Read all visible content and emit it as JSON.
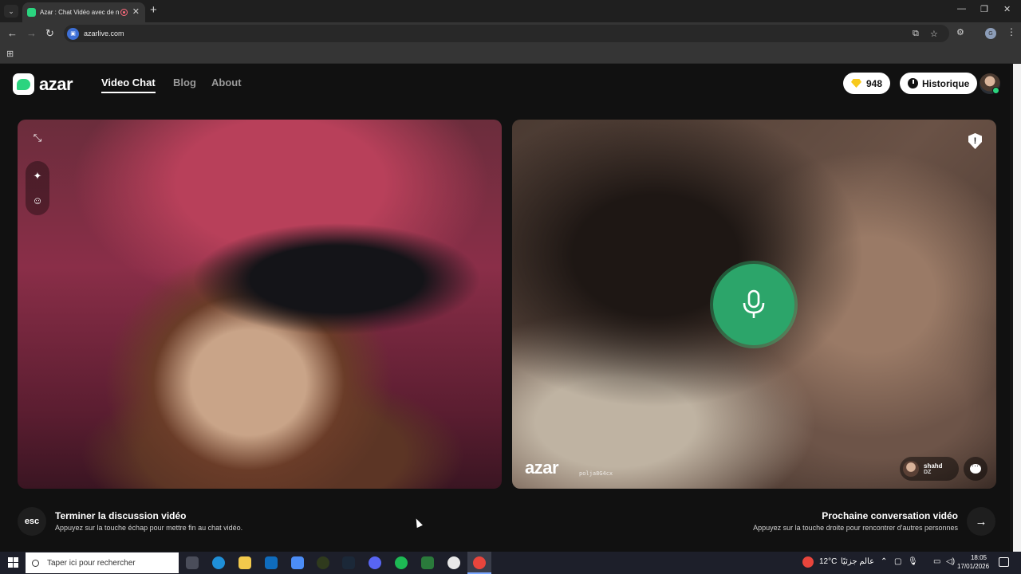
{
  "browser": {
    "tab_title": "Azar : Chat Vidéo avec de n",
    "url": "azarlive.com"
  },
  "header": {
    "logo_text": "azar",
    "nav": [
      "Video Chat",
      "Blog",
      "About"
    ],
    "gems_count": "948",
    "history_label": "Historique"
  },
  "remote_video": {
    "watermark": "azar",
    "session_id": "polja8G4cx",
    "peer_name": "shahd",
    "peer_country": "DZ"
  },
  "controls": {
    "esc_key": "esc",
    "end_title": "Terminer la discussion vidéo",
    "end_subtitle": "Appuyez sur la touche échap pour mettre fin au chat vidéo.",
    "next_title": "Prochaine conversation vidéo",
    "next_subtitle": "Appuyez sur la touche droite pour rencontrer d'autres personnes"
  },
  "taskbar": {
    "search_placeholder": "Taper ici pour rechercher",
    "weather": "12°C",
    "weather_label": "عالم جزئيًا",
    "time": "18:05",
    "date": "17/01/2026"
  },
  "colors": {
    "accent_green": "#2bd47f",
    "mic_green": "#2ca56a",
    "gem_yellow": "#f7c91c",
    "background": "#111111"
  },
  "icons": [
    "minimize-icon",
    "magic-wand-icon",
    "emoji-icon",
    "shield-report-icon",
    "microphone-icon",
    "chat-icon",
    "arrow-right-icon"
  ]
}
